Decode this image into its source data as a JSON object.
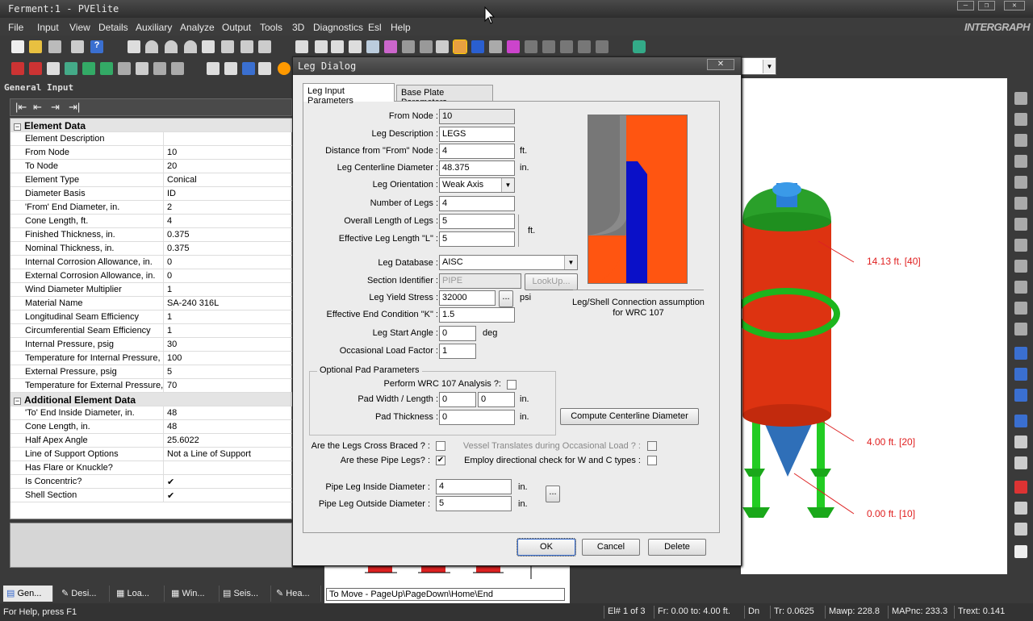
{
  "window": {
    "title": "Ferment:1 - PVElite",
    "brand": "INTERGRAPH"
  },
  "menu": [
    "File",
    "Input",
    "View",
    "Details",
    "Auxiliary",
    "Analyze",
    "Output",
    "Tools",
    "3D",
    "Diagnostics",
    "Esl",
    "Help"
  ],
  "general_input": {
    "title": "General Input",
    "sections": [
      {
        "title": "Element Data",
        "rows": [
          {
            "name": "Element Description",
            "value": ""
          },
          {
            "name": "From Node",
            "value": "10"
          },
          {
            "name": "To Node",
            "value": "20"
          },
          {
            "name": "Element Type",
            "value": "Conical"
          },
          {
            "name": "Diameter Basis",
            "value": "ID"
          },
          {
            "name": "'From' End Diameter, in.",
            "value": "2"
          },
          {
            "name": "Cone Length, ft.",
            "value": "4"
          },
          {
            "name": "Finished Thickness, in.",
            "value": "0.375"
          },
          {
            "name": "Nominal Thickness,  in.",
            "value": "0.375"
          },
          {
            "name": "Internal Corrosion Allowance,  in.",
            "value": "0"
          },
          {
            "name": "External Corrosion Allowance,  in.",
            "value": "0"
          },
          {
            "name": "Wind Diameter Multiplier",
            "value": "1"
          },
          {
            "name": "Material Name",
            "value": "SA-240 316L"
          },
          {
            "name": "Longitudinal Seam Efficiency",
            "value": "1"
          },
          {
            "name": "Circumferential Seam Efficiency",
            "value": "1"
          },
          {
            "name": "Internal Pressure,  psig",
            "value": "30"
          },
          {
            "name": "Temperature for Internal Pressure,",
            "value": "100"
          },
          {
            "name": "External Pressure,  psig",
            "value": "5"
          },
          {
            "name": "Temperature for External Pressure,",
            "value": "70"
          }
        ]
      },
      {
        "title": "Additional Element Data",
        "rows": [
          {
            "name": "'To' End Inside Diameter, in.",
            "value": "48"
          },
          {
            "name": "Cone Length, in.",
            "value": "48"
          },
          {
            "name": "Half Apex Angle",
            "value": "25.6022"
          },
          {
            "name": "Line of Support Options",
            "value": "Not a Line of Support"
          },
          {
            "name": "Has Flare or Knuckle?",
            "value": ""
          },
          {
            "name": "Is Concentric?",
            "value": "✔"
          },
          {
            "name": "Shell Section",
            "value": "✔"
          }
        ]
      }
    ]
  },
  "bottom_tabs": [
    "Gen...",
    "Desi...",
    "Loa...",
    "Win...",
    "Seis...",
    "Hea..."
  ],
  "move_hint": "To Move - PageUp\\PageDown\\Home\\End",
  "status": {
    "help": "For Help, press F1",
    "cells": [
      "El# 1 of 3",
      "Fr: 0.00 to: 4.00 ft.",
      "Dn",
      "Tr: 0.0625",
      "Mawp: 228.8",
      "MAPnc: 233.3",
      "Trext: 0.141"
    ]
  },
  "viewport": {
    "labels": [
      "14.13 ft.  [40]",
      "4.00 ft.  [20]",
      "0.00 ft.  [10]"
    ],
    "label_color": "#e02020"
  },
  "dialog": {
    "title": "Leg Dialog",
    "close": "✕",
    "tabs": [
      "Leg Input Parameters",
      "Base Plate Parameters"
    ],
    "from_node": {
      "label": "From Node :",
      "value": "10"
    },
    "leg_description": {
      "label": "Leg Description :",
      "value": "LEGS"
    },
    "distance": {
      "label": "Distance from \"From\" Node :",
      "value": "4",
      "unit": "ft."
    },
    "centerline_dia": {
      "label": "Leg Centerline Diameter :",
      "value": "48.375",
      "unit": "in."
    },
    "orientation": {
      "label": "Leg Orientation :",
      "value": "Weak Axis"
    },
    "num_legs": {
      "label": "Number of Legs :",
      "value": "4"
    },
    "overall_length": {
      "label": "Overall Length of Legs :",
      "value": "5"
    },
    "effective_length": {
      "label": "Effective Leg Length \"L\" :",
      "value": "5"
    },
    "length_unit": "ft.",
    "database": {
      "label": "Leg Database :",
      "value": "AISC"
    },
    "section_id": {
      "label": "Section Identifier :",
      "value": "PIPE",
      "lookup": "LookUp..."
    },
    "yield_stress": {
      "label": "Leg Yield Stress :",
      "value": "32000",
      "unit": "psi",
      "browse": "..."
    },
    "end_condition": {
      "label": "Effective End Condition \"K\" :",
      "value": "1.5"
    },
    "start_angle": {
      "label": "Leg Start Angle :",
      "value": "0",
      "unit": "deg"
    },
    "load_factor": {
      "label": "Occasional Load Factor :",
      "value": "1"
    },
    "preview_caption": "Leg/Shell Connection assumption\nfor WRC 107",
    "pad": {
      "title": "Optional Pad Parameters",
      "wrc_label": "Perform WRC 107 Analysis ?:",
      "width_label": "Pad Width / Length :",
      "width": "0",
      "length": "0",
      "width_unit": "in.",
      "thickness_label": "Pad Thickness :",
      "thickness": "0",
      "thickness_unit": "in."
    },
    "compute_button": "Compute Centerline Diameter",
    "cross_braced": {
      "label": "Are the Legs Cross Braced ? :",
      "checked": false
    },
    "pipe_legs": {
      "label": "Are these Pipe Legs? :",
      "checked": true
    },
    "vessel_translates": {
      "label": "Vessel Translates during Occasional Load ? :",
      "checked": false
    },
    "directional_check": {
      "label": "Employ directional check for W and C types :",
      "checked": false
    },
    "pipe_inside": {
      "label": "Pipe Leg Inside Diameter :",
      "value": "4",
      "unit": "in."
    },
    "pipe_outside": {
      "label": "Pipe Leg Outside Diameter :",
      "value": "5",
      "unit": "in."
    },
    "pipe_browse": "...",
    "ok": "OK",
    "cancel": "Cancel",
    "delete": "Delete"
  }
}
